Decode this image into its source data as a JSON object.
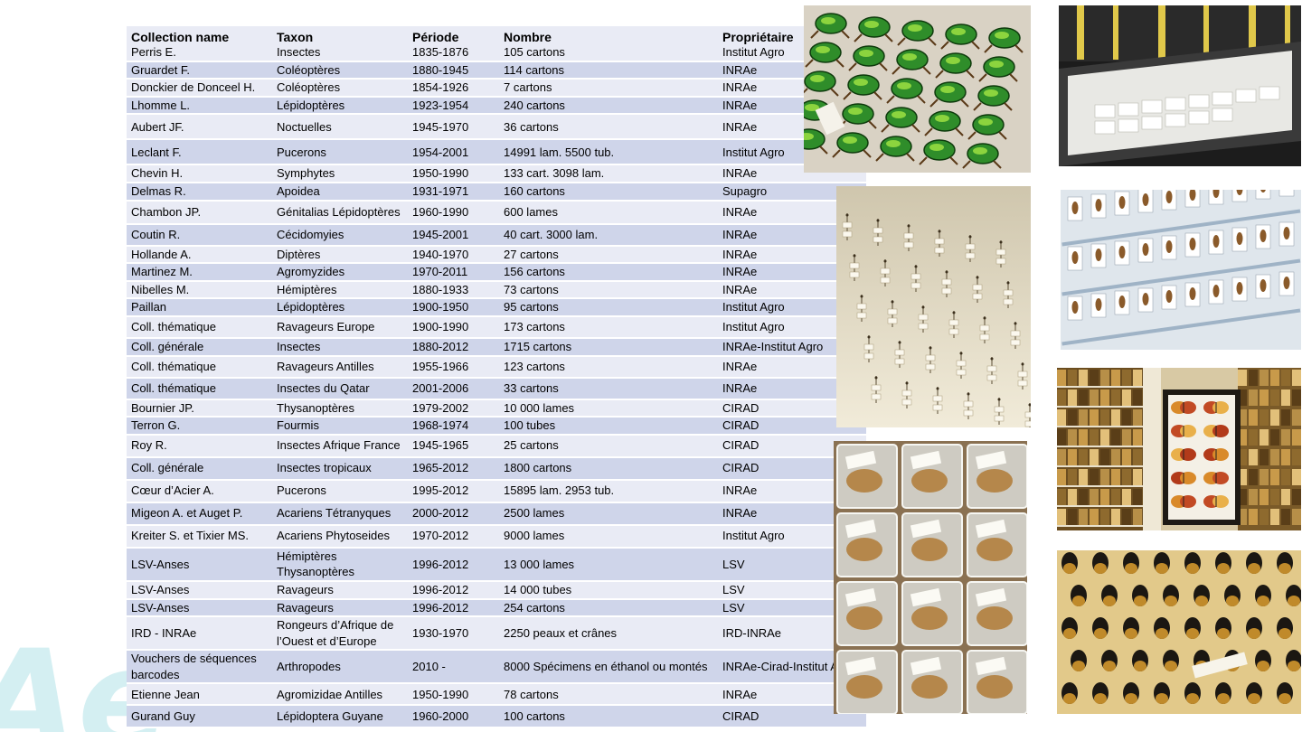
{
  "table": {
    "headers": [
      "Collection name",
      "Taxon",
      "Période",
      "Nombre",
      "Propriétaire"
    ],
    "rows": [
      [
        "Perris E.",
        "Insectes",
        "1835-1876",
        "105 cartons",
        "Institut Agro"
      ],
      [
        "Gruardet F.",
        "Coléoptères",
        "1880-1945",
        "114 cartons",
        "INRAe"
      ],
      [
        "Donckier de Donceel H.",
        "Coléoptères",
        "1854-1926",
        "7 cartons",
        "INRAe"
      ],
      [
        "Lhomme L.",
        "Lépidoptères",
        "1923-1954",
        "240 cartons",
        "INRAe"
      ],
      [
        "Aubert JF.",
        "Noctuelles",
        "1945-1970",
        "36 cartons",
        "INRAe"
      ],
      [
        "Leclant F.",
        "Pucerons",
        "1954-2001",
        "14991 lam. 5500 tub.",
        "Institut Agro"
      ],
      [
        "Chevin H.",
        "Symphytes",
        "1950-1990",
        "133 cart. 3098 lam.",
        "INRAe"
      ],
      [
        "Delmas R.",
        "Apoidea",
        "1931-1971",
        "160 cartons",
        "Supagro"
      ],
      [
        "Chambon JP.",
        "Génitalias Lépidoptères",
        "1960-1990",
        "600 lames",
        "INRAe"
      ],
      [
        "Coutin R.",
        "Cécidomyies",
        "1945-2001",
        "40 cart. 3000 lam.",
        "INRAe"
      ],
      [
        "Hollande A.",
        "Diptères",
        "1940-1970",
        "27 cartons",
        "INRAe"
      ],
      [
        "Martinez M.",
        "Agromyzides",
        "1970-2011",
        "156 cartons",
        "INRAe"
      ],
      [
        "Nibelles M.",
        "Hémiptères",
        "1880-1933",
        "73 cartons",
        "INRAe"
      ],
      [
        "Paillan",
        "Lépidoptères",
        "1900-1950",
        "95 cartons",
        "Institut Agro"
      ],
      [
        "Coll. thématique",
        "Ravageurs Europe",
        "1900-1990",
        "173 cartons",
        "Institut Agro"
      ],
      [
        "Coll. générale",
        "Insectes",
        "1880-2012",
        "1715 cartons",
        "INRAe-Institut Agro"
      ],
      [
        "Coll. thématique",
        "Ravageurs Antilles",
        "1955-1966",
        "123 cartons",
        "INRAe"
      ],
      [
        "Coll. thématique",
        "Insectes du Qatar",
        "2001-2006",
        "33 cartons",
        "INRAe"
      ],
      [
        "Bournier JP.",
        "Thysanoptères",
        "1979-2002",
        "10 000 lames",
        "CIRAD"
      ],
      [
        "Terron G.",
        "Fourmis",
        "1968-1974",
        "100 tubes",
        "CIRAD"
      ],
      [
        "Roy R.",
        "Insectes Afrique France",
        "1945-1965",
        "25 cartons",
        "CIRAD"
      ],
      [
        "Coll. générale",
        "Insectes tropicaux",
        "1965-2012",
        "1800 cartons",
        "CIRAD"
      ],
      [
        "Cœur d’Acier A.",
        "Pucerons",
        "1995-2012",
        "15895 lam. 2953 tub.",
        "INRAe"
      ],
      [
        "Migeon A. et Auget P.",
        "Acariens Tétranyques",
        "2000-2012",
        "2500 lames",
        "INRAe"
      ],
      [
        "Kreiter S. et Tixier MS.",
        "Acariens Phytoseides",
        "1970-2012",
        "9000 lames",
        "Institut Agro"
      ],
      [
        "LSV-Anses",
        "Hémiptères Thysanoptères",
        "1996-2012",
        "13 000 lames",
        "LSV"
      ],
      [
        "LSV-Anses",
        "Ravageurs",
        "1996-2012",
        "14 000 tubes",
        "LSV"
      ],
      [
        "LSV-Anses",
        "Ravageurs",
        "1996-2012",
        "254 cartons",
        "LSV"
      ],
      [
        "IRD - INRAe",
        "Rongeurs d’Afrique de l’Ouest et d’Europe",
        "1930-1970",
        "2250 peaux et crânes",
        "IRD-INRAe"
      ],
      [
        "Vouchers de séquences barcodes",
        "Arthropodes",
        "2010 -",
        "8000 Spécimens en éthanol ou montés",
        "INRAe-Cirad-Institut Agro"
      ],
      [
        "Etienne Jean",
        "Agromizidae Antilles",
        "1950-1990",
        "78 cartons",
        "INRAe"
      ],
      [
        "Gurand Guy",
        "Lépidoptera Guyane",
        "1960-2000",
        "100 cartons",
        "CIRAD"
      ]
    ]
  },
  "photos": [
    {
      "name": "green-beetles-photo"
    },
    {
      "name": "slide-drawer-photo"
    },
    {
      "name": "pinned-micro-insects-photo"
    },
    {
      "name": "labeled-specimens-drawer-photo"
    },
    {
      "name": "vial-boxes-photo"
    },
    {
      "name": "shelves-butterfly-box-photo"
    },
    {
      "name": "dark-beetles-photo"
    }
  ],
  "logo": {
    "text": "Ae"
  }
}
